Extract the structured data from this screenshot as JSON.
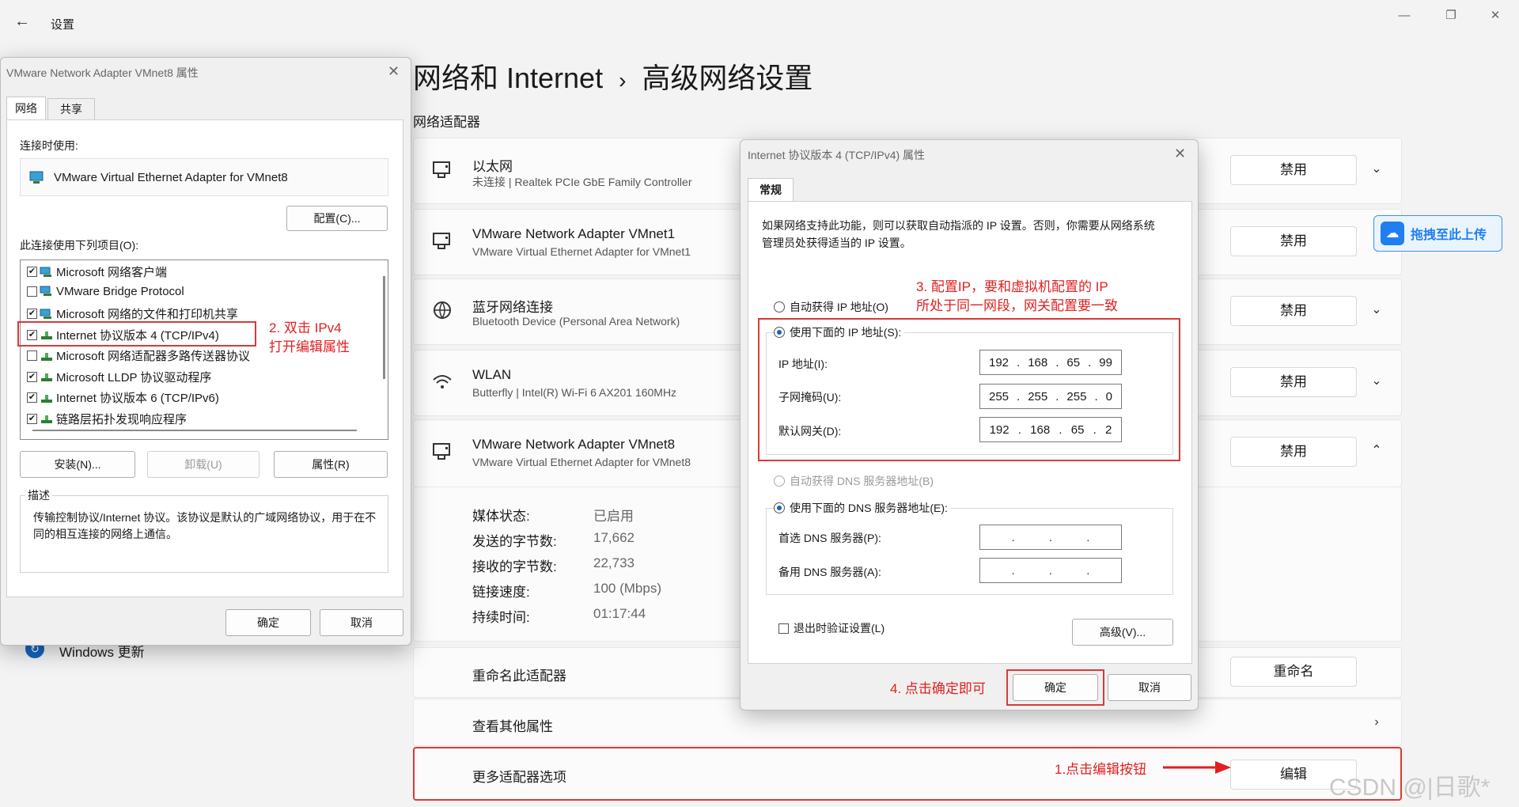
{
  "window": {
    "title": "设置"
  },
  "breadcrumb": {
    "parent": "网络和 Internet",
    "separator": "›",
    "current": "高级网络设置"
  },
  "section": {
    "title": "网络适配器"
  },
  "adapters": [
    {
      "name": "以太网",
      "sub": "未连接 | Realtek PCIe GbE Family Controller",
      "button": "禁用"
    },
    {
      "name": "VMware Network Adapter VMnet1",
      "sub": "VMware Virtual Ethernet Adapter for VMnet1",
      "button": "禁用"
    },
    {
      "name": "蓝牙网络连接",
      "sub": "Bluetooth Device (Personal Area Network)",
      "button": "禁用"
    },
    {
      "name": "WLAN",
      "sub": "Butterfly | Intel(R) Wi-Fi 6 AX201 160MHz",
      "button": "禁用"
    },
    {
      "name": "VMware Network Adapter VMnet8",
      "sub": "VMware Virtual Ethernet Adapter for VMnet8",
      "button": "禁用"
    }
  ],
  "vmnet8_details": [
    {
      "label": "媒体状态:",
      "value": "已启用"
    },
    {
      "label": "发送的字节数:",
      "value": "17,662"
    },
    {
      "label": "接收的字节数:",
      "value": "22,733"
    },
    {
      "label": "链接速度:",
      "value": "100 (Mbps)"
    },
    {
      "label": "持续时间:",
      "value": "01:17:44"
    }
  ],
  "rename_row": {
    "label": "重命名此适配器",
    "button": "重命名"
  },
  "other_props": {
    "label": "查看其他属性"
  },
  "more_options": {
    "label": "更多适配器选项",
    "button": "编辑"
  },
  "windows_update": {
    "label": "Windows 更新"
  },
  "upload_badge": {
    "label": "拖拽至此上传"
  },
  "watermark": "CSDN @|日歌*",
  "annotations": {
    "step1": "1.点击编辑按钮",
    "step2_line1": "2. 双击  IPv4",
    "step2_line2": "打开编辑属性",
    "step3_line1": "3. 配置IP，要和虚拟机配置的 IP",
    "step3_line2": "所处于同一网段，网关配置要一致",
    "step4": "4. 点击确定即可"
  },
  "props_dialog": {
    "title": "VMware Network Adapter VMnet8 属性",
    "tabs": [
      "网络",
      "共享"
    ],
    "connect_using_label": "连接时使用:",
    "adapter_name": "VMware Virtual Ethernet Adapter for VMnet8",
    "configure_button": "配置(C)...",
    "items_label": "此连接使用下列项目(O):",
    "items": [
      {
        "label": "Microsoft 网络客户端",
        "checked": true
      },
      {
        "label": "VMware Bridge Protocol",
        "checked": false
      },
      {
        "label": "Microsoft 网络的文件和打印机共享",
        "checked": true
      },
      {
        "label": "Internet 协议版本 4 (TCP/IPv4)",
        "checked": true
      },
      {
        "label": "Microsoft 网络适配器多路传送器协议",
        "checked": false
      },
      {
        "label": "Microsoft LLDP 协议驱动程序",
        "checked": true
      },
      {
        "label": "Internet 协议版本 6 (TCP/IPv6)",
        "checked": true
      },
      {
        "label": "链路层拓扑发现响应程序",
        "checked": true
      }
    ],
    "install_button": "安装(N)...",
    "uninstall_button": "卸载(U)",
    "properties_button": "属性(R)",
    "description_label": "描述",
    "description": "传输控制协议/Internet 协议。该协议是默认的广域网络协议，用于在不同的相互连接的网络上通信。",
    "ok_button": "确定",
    "cancel_button": "取消"
  },
  "ipv4_dialog": {
    "title": "Internet 协议版本 4 (TCP/IPv4) 属性",
    "tab": "常规",
    "intro": "如果网络支持此功能，则可以获取自动指派的 IP 设置。否则，你需要从网络系统管理员处获得适当的 IP 设置。",
    "auto_ip": "自动获得 IP 地址(O)",
    "manual_ip": "使用下面的 IP 地址(S):",
    "ip_label": "IP 地址(I):",
    "ip_value": [
      "192",
      "168",
      "65",
      "99"
    ],
    "mask_label": "子网掩码(U):",
    "mask_value": [
      "255",
      "255",
      "255",
      "0"
    ],
    "gateway_label": "默认网关(D):",
    "gateway_value": [
      "192",
      "168",
      "65",
      "2"
    ],
    "auto_dns": "自动获得 DNS 服务器地址(B)",
    "manual_dns": "使用下面的 DNS 服务器地址(E):",
    "pref_dns_label": "首选 DNS 服务器(P):",
    "alt_dns_label": "备用 DNS 服务器(A):",
    "validate_label": "退出时验证设置(L)",
    "advanced_button": "高级(V)...",
    "ok_button": "确定",
    "cancel_button": "取消"
  }
}
